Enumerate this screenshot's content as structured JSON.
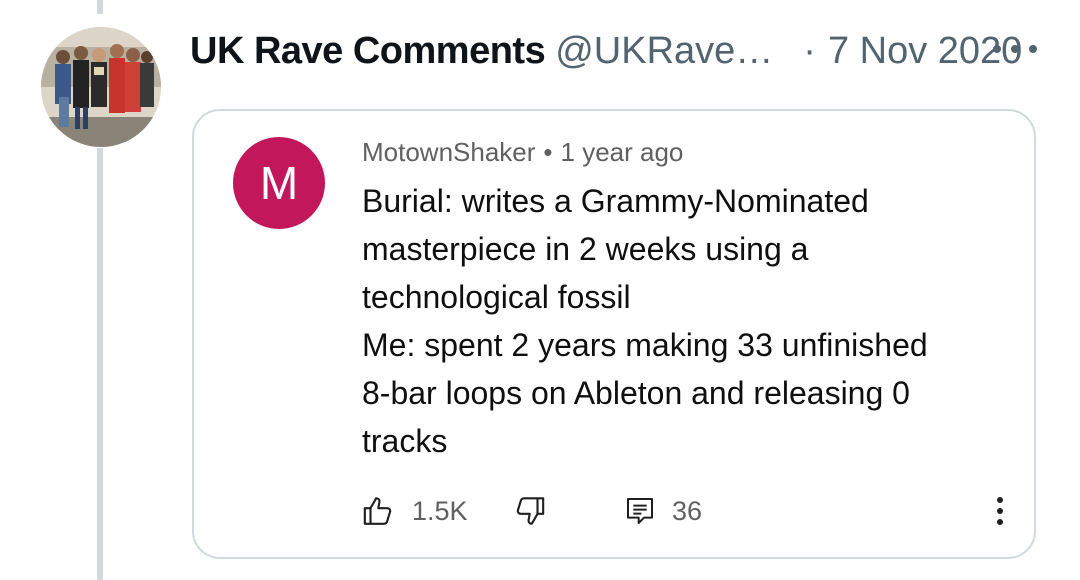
{
  "tweet": {
    "display_name": "UK Rave Comments",
    "handle": "@UKRave…",
    "separator": "·",
    "date": "7 Nov 2020",
    "more_icon": "more-horizontal-icon",
    "avatar_icon": "group-photo-avatar"
  },
  "embedded_comment": {
    "avatar_letter": "M",
    "avatar_color": "#c2185b",
    "username": "MotownShaker",
    "dot": "•",
    "time": "1 year ago",
    "text_lines": [
      "Burial: writes a Grammy-Nominated",
      "masterpiece in 2 weeks using a",
      "technological fossil",
      "Me: spent 2 years making 33 unfinished",
      "8-bar loops on Ableton and releasing 0",
      "tracks"
    ],
    "likes": "1.5K",
    "replies": "36",
    "icons": {
      "like": "thumbs-up-icon",
      "dislike": "thumbs-down-icon",
      "reply": "comment-icon",
      "more": "more-vertical-icon"
    }
  }
}
